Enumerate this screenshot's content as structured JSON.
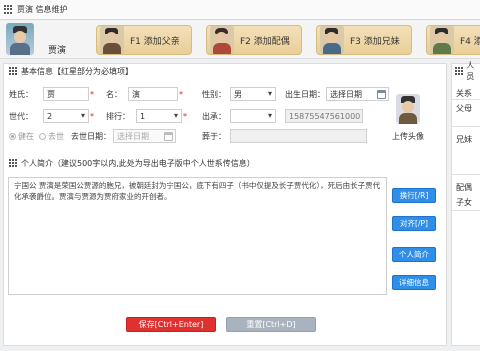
{
  "window": {
    "title": "贾演 信息维护"
  },
  "person": {
    "name": "贾演"
  },
  "relatives": [
    {
      "label": "F1 添加父亲"
    },
    {
      "label": "F2 添加配偶"
    },
    {
      "label": "F3 添加兄妹"
    },
    {
      "label": "F4 添"
    }
  ],
  "basic": {
    "section_title": "基本信息【红星部分为必填项】",
    "surname_label": "姓氏：",
    "surname_value": "贾",
    "given_label": "名：",
    "given_value": "演",
    "gender_label": "性别：",
    "gender_value": "男",
    "birth_label": "出生日期：",
    "birth_value": "选择日期",
    "gen_label": "世代：",
    "gen_value": "2",
    "rank_label": "排行：",
    "rank_value": "1",
    "branch_label": "出承：",
    "branch_value": "",
    "phone_value": "15875547561000",
    "alive_label": "健在",
    "dead_label": "去世",
    "death_label": "去世日期：",
    "death_value": "选择日期",
    "burial_label": "葬于：",
    "burial_value": "",
    "upload_label": "上传头像"
  },
  "intro": {
    "section_title": "个人简介（建议500字以内,此处为导出电子版中个人世系传信息）",
    "text": "宁国公 贾演是荣国公贾源的胞兄，被朝廷封为宁国公，底下有四子（书中仅提及长子贾代化），死后由长子贾代化承袭爵位。贾演与贾源为贾府家业的开创者。",
    "buttons": [
      "换行[/R]",
      "对齐[/P]",
      "个人简介",
      "详细信息"
    ]
  },
  "footer": {
    "save": "保存[Ctrl+Enter]",
    "reset": "重置[Ctrl+D]"
  },
  "right_panel": {
    "title": "人员",
    "items": [
      "关系",
      "父母",
      "兄妹",
      "配偶",
      "子女"
    ]
  },
  "colors": {
    "accent": "#2f8ee8",
    "save": "#e03030",
    "reset": "#a9b3bf",
    "required": "#e02020"
  }
}
